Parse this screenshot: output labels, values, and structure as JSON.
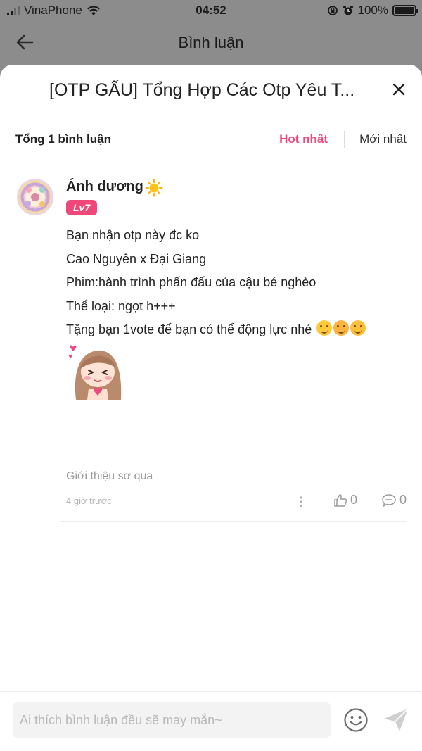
{
  "status_bar": {
    "carrier": "VinaPhone",
    "time": "04:52",
    "battery": "100%"
  },
  "background_screen": {
    "title": "Bình luận"
  },
  "sheet": {
    "title": "[OTP GẤU] Tổng Hợp Các Otp Yêu T..."
  },
  "summary": {
    "count_label": "Tổng 1 bình luận",
    "sort_options": [
      "Hot nhất",
      "Mới nhất"
    ],
    "active_sort": "Hot nhất",
    "accent_color": "#f0477a"
  },
  "comment": {
    "username": "Ánh dương",
    "username_icon": "sun-icon",
    "level": "Lv7",
    "lines": [
      "Bạn nhận otp này đc ko",
      "Cao Nguyên x Đại Giang",
      "Phim:hành trình phấn đấu của cậu bé nghèo",
      "Thể loại: ngọt h+++",
      "Tặng bạn 1vote để bạn có thể động lực nhé"
    ],
    "line_emojis": [
      "smiling-face-icon",
      "smiling-face-with-hearts-icon",
      "face-blowing-kiss-icon"
    ],
    "sticker": "anime-girl-sticker",
    "caption": "Giới thiệu sơ qua",
    "timestamp": "4 giờ trước",
    "likes": "0",
    "replies": "0"
  },
  "composer": {
    "placeholder": "Ai thích bình luận đều sẽ may mắn~"
  }
}
